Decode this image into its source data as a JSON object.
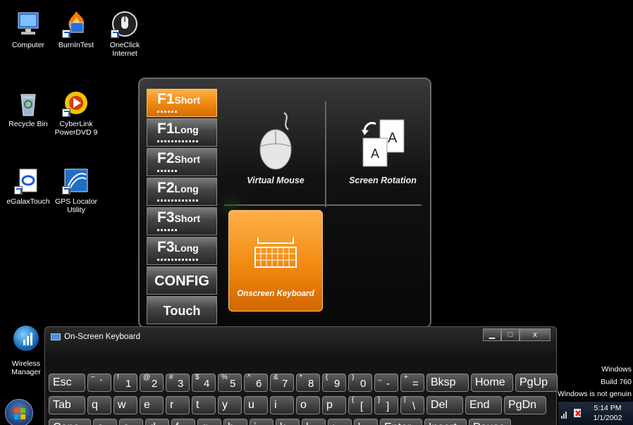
{
  "desktop_icons": [
    {
      "label": "Computer",
      "icon": "computer-icon"
    },
    {
      "label": "BurnInTest",
      "icon": "burnintest-icon"
    },
    {
      "label": "OneClick Internet",
      "icon": "oneclick-internet-icon"
    },
    {
      "label": "Recycle Bin",
      "icon": "recycle-bin-icon"
    },
    {
      "label": "CyberLink PowerDVD 9",
      "icon": "powerdvd-icon"
    },
    {
      "label": "eGalaxTouch",
      "icon": "egalaxtouch-icon"
    },
    {
      "label": "GPS Locator Utility",
      "icon": "gps-locator-icon"
    },
    {
      "label": "Wireless Manager",
      "icon": "wireless-manager-icon"
    }
  ],
  "hotkey_panel": {
    "buttons": [
      {
        "key": "F1",
        "mode": "Short",
        "active": true
      },
      {
        "key": "F1",
        "mode": "Long",
        "active": false
      },
      {
        "key": "F2",
        "mode": "Short",
        "active": false
      },
      {
        "key": "F2",
        "mode": "Long",
        "active": false
      },
      {
        "key": "F3",
        "mode": "Short",
        "active": false
      },
      {
        "key": "F3",
        "mode": "Long",
        "active": false
      }
    ],
    "config_label": "CONFIG",
    "touch_lock_label": "Touch Lock",
    "virtual_mouse_label": "Virtual Mouse",
    "screen_rotation_label": "Screen Rotation",
    "onscreen_keyboard_label": "Onscreen Keyboard",
    "accent_color": "#f08a10"
  },
  "osk": {
    "title": "On-Screen Keyboard",
    "row1": [
      {
        "main": "Esc"
      },
      {
        "shift": "~",
        "main": "`"
      },
      {
        "shift": "!",
        "main": "1"
      },
      {
        "shift": "@",
        "main": "2"
      },
      {
        "shift": "#",
        "main": "3"
      },
      {
        "shift": "$",
        "main": "4"
      },
      {
        "shift": "%",
        "main": "5"
      },
      {
        "shift": "^",
        "main": "6"
      },
      {
        "shift": "&",
        "main": "7"
      },
      {
        "shift": "*",
        "main": "8"
      },
      {
        "shift": "(",
        "main": "9"
      },
      {
        "shift": ")",
        "main": "0"
      },
      {
        "shift": "_",
        "main": "-"
      },
      {
        "shift": "+",
        "main": "="
      },
      {
        "main": "Bksp"
      },
      {
        "main": "Home"
      },
      {
        "main": "PgUp"
      }
    ],
    "row2": [
      {
        "main": "Tab"
      },
      {
        "main": "q"
      },
      {
        "main": "w"
      },
      {
        "main": "e"
      },
      {
        "main": "r"
      },
      {
        "main": "t"
      },
      {
        "main": "y"
      },
      {
        "main": "u"
      },
      {
        "main": "i"
      },
      {
        "main": "o"
      },
      {
        "main": "p"
      },
      {
        "shift": "{",
        "main": "["
      },
      {
        "shift": "}",
        "main": "]"
      },
      {
        "shift": "|",
        "main": "\\"
      },
      {
        "main": "Del"
      },
      {
        "main": "End"
      },
      {
        "main": "PgDn"
      }
    ],
    "row3": [
      {
        "main": "Caps"
      },
      {
        "main": "a"
      },
      {
        "main": "s"
      },
      {
        "main": "d"
      },
      {
        "main": "f"
      },
      {
        "main": "g"
      },
      {
        "main": "h"
      },
      {
        "main": "j"
      },
      {
        "main": "k"
      },
      {
        "main": "l"
      },
      {
        "main": ";"
      },
      {
        "main": "'"
      },
      {
        "main": "Enter"
      },
      {
        "main": "Insert"
      },
      {
        "main": "Pause"
      }
    ]
  },
  "system": {
    "windows_label": "Windows",
    "build_label": "Build 760",
    "not_genuine": "Windows is not genuin",
    "time": "5:14 PM",
    "date": "1/1/2002"
  }
}
